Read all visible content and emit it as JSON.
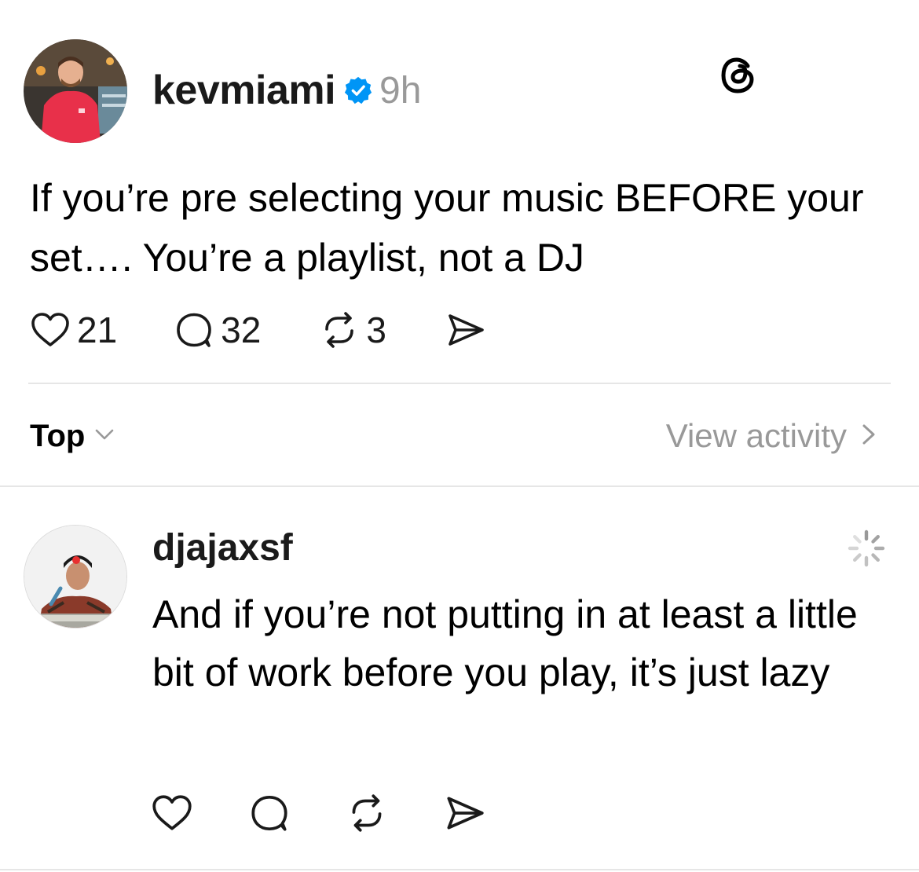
{
  "post": {
    "username": "kevmiami",
    "verified_icon": "verified-badge-icon",
    "timestamp": "9h",
    "text": "If you’re pre selecting your music BEFORE your set…. You’re a playlist, not a DJ",
    "likes": "21",
    "replies": "32",
    "reposts": "3"
  },
  "header": {
    "logo_icon": "threads-logo-icon"
  },
  "sort": {
    "label": "Top",
    "icon": "chevron-down-icon"
  },
  "activity": {
    "label": "View activity",
    "icon": "chevron-right-icon"
  },
  "reply": {
    "username": "djajaxsf",
    "text": "And if you’re not putting in at least a little bit of work before you play, it’s just lazy",
    "status_icon": "loading-spinner-icon"
  },
  "colors": {
    "accent_verified": "#0095f6",
    "muted_text": "#999999",
    "divider": "#e6e6e6"
  }
}
